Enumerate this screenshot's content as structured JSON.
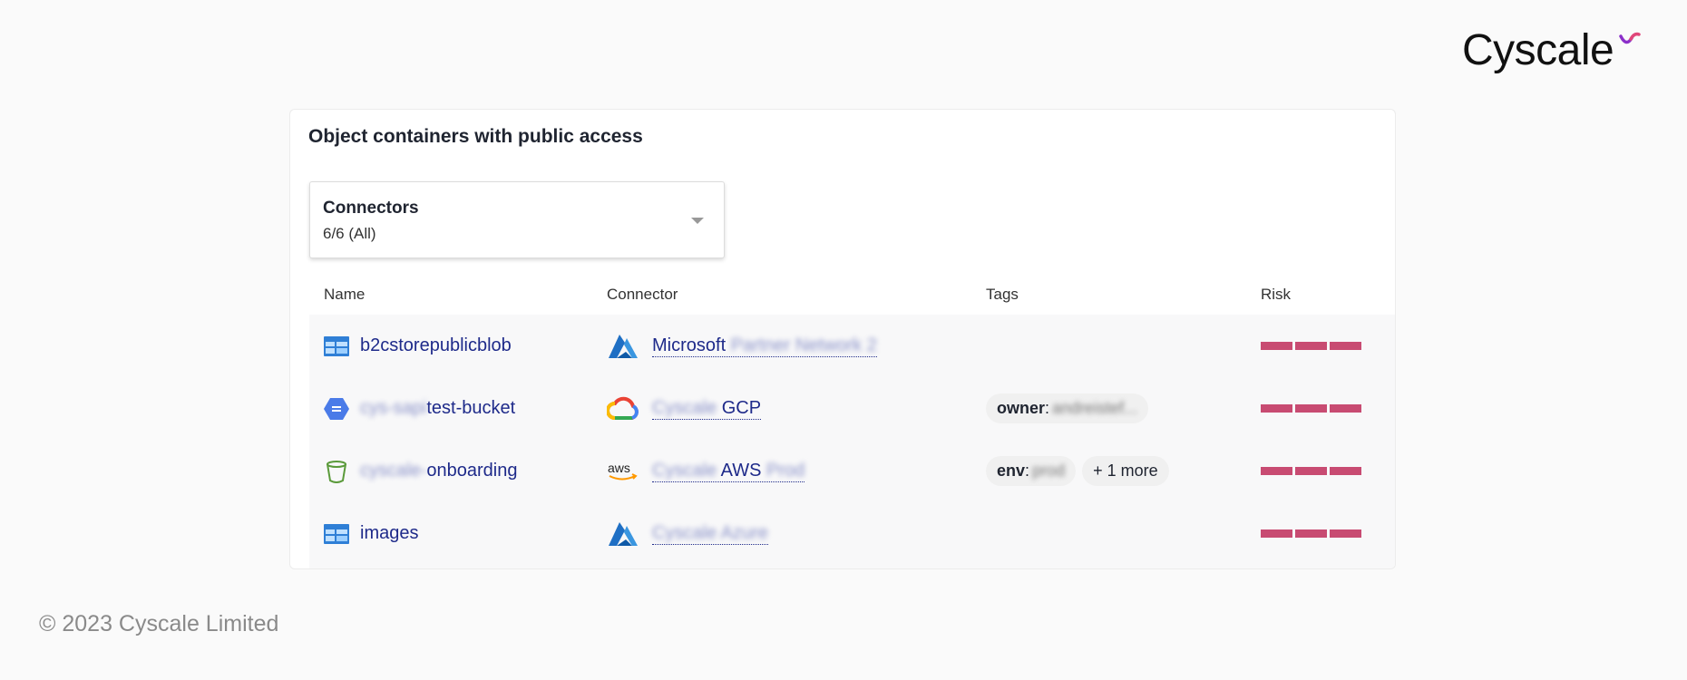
{
  "brand": {
    "logo_text": "Cyscale",
    "accent_color": "#7c3aed"
  },
  "card": {
    "title": "Object containers with public access",
    "filter": {
      "label": "Connectors",
      "value": "6/6 (All)"
    },
    "columns": {
      "name": "Name",
      "connector": "Connector",
      "tags": "Tags",
      "risk": "Risk"
    },
    "rows": [
      {
        "icon": "azure-storage-icon",
        "name_blur": "",
        "name": "b2cstorepublicblob",
        "connector_icon": "azure-icon",
        "connector_pre": "",
        "connector": "Microsoft",
        "connector_post": "Partner Network 2",
        "tags": [],
        "risk_level": 3
      },
      {
        "icon": "gcp-storage-icon",
        "name_blur": "cys-sapi",
        "name": "test-bucket",
        "connector_icon": "gcp-icon",
        "connector_pre": "Cyscale",
        "connector": "GCP",
        "connector_post": "",
        "tags": [
          {
            "key": "owner",
            "value": "andreistef..."
          }
        ],
        "risk_level": 3
      },
      {
        "icon": "s3-bucket-icon",
        "name_blur": "cyscale-",
        "name": "onboarding",
        "connector_icon": "aws-icon",
        "connector_pre": "Cyscale",
        "connector": "AWS",
        "connector_post": "Prod",
        "tags": [
          {
            "key": "env",
            "value": "prod"
          }
        ],
        "more": "+ 1 more",
        "risk_level": 3
      },
      {
        "icon": "azure-storage-icon",
        "name_blur": "",
        "name": "images",
        "connector_icon": "azure-icon",
        "connector_pre": "Cyscale Azure",
        "connector": "",
        "connector_post": "",
        "tags": [],
        "risk_level": 3
      }
    ],
    "risk_color": "#c84b72"
  },
  "footer": {
    "copyright": "© 2023 Cyscale Limited"
  }
}
